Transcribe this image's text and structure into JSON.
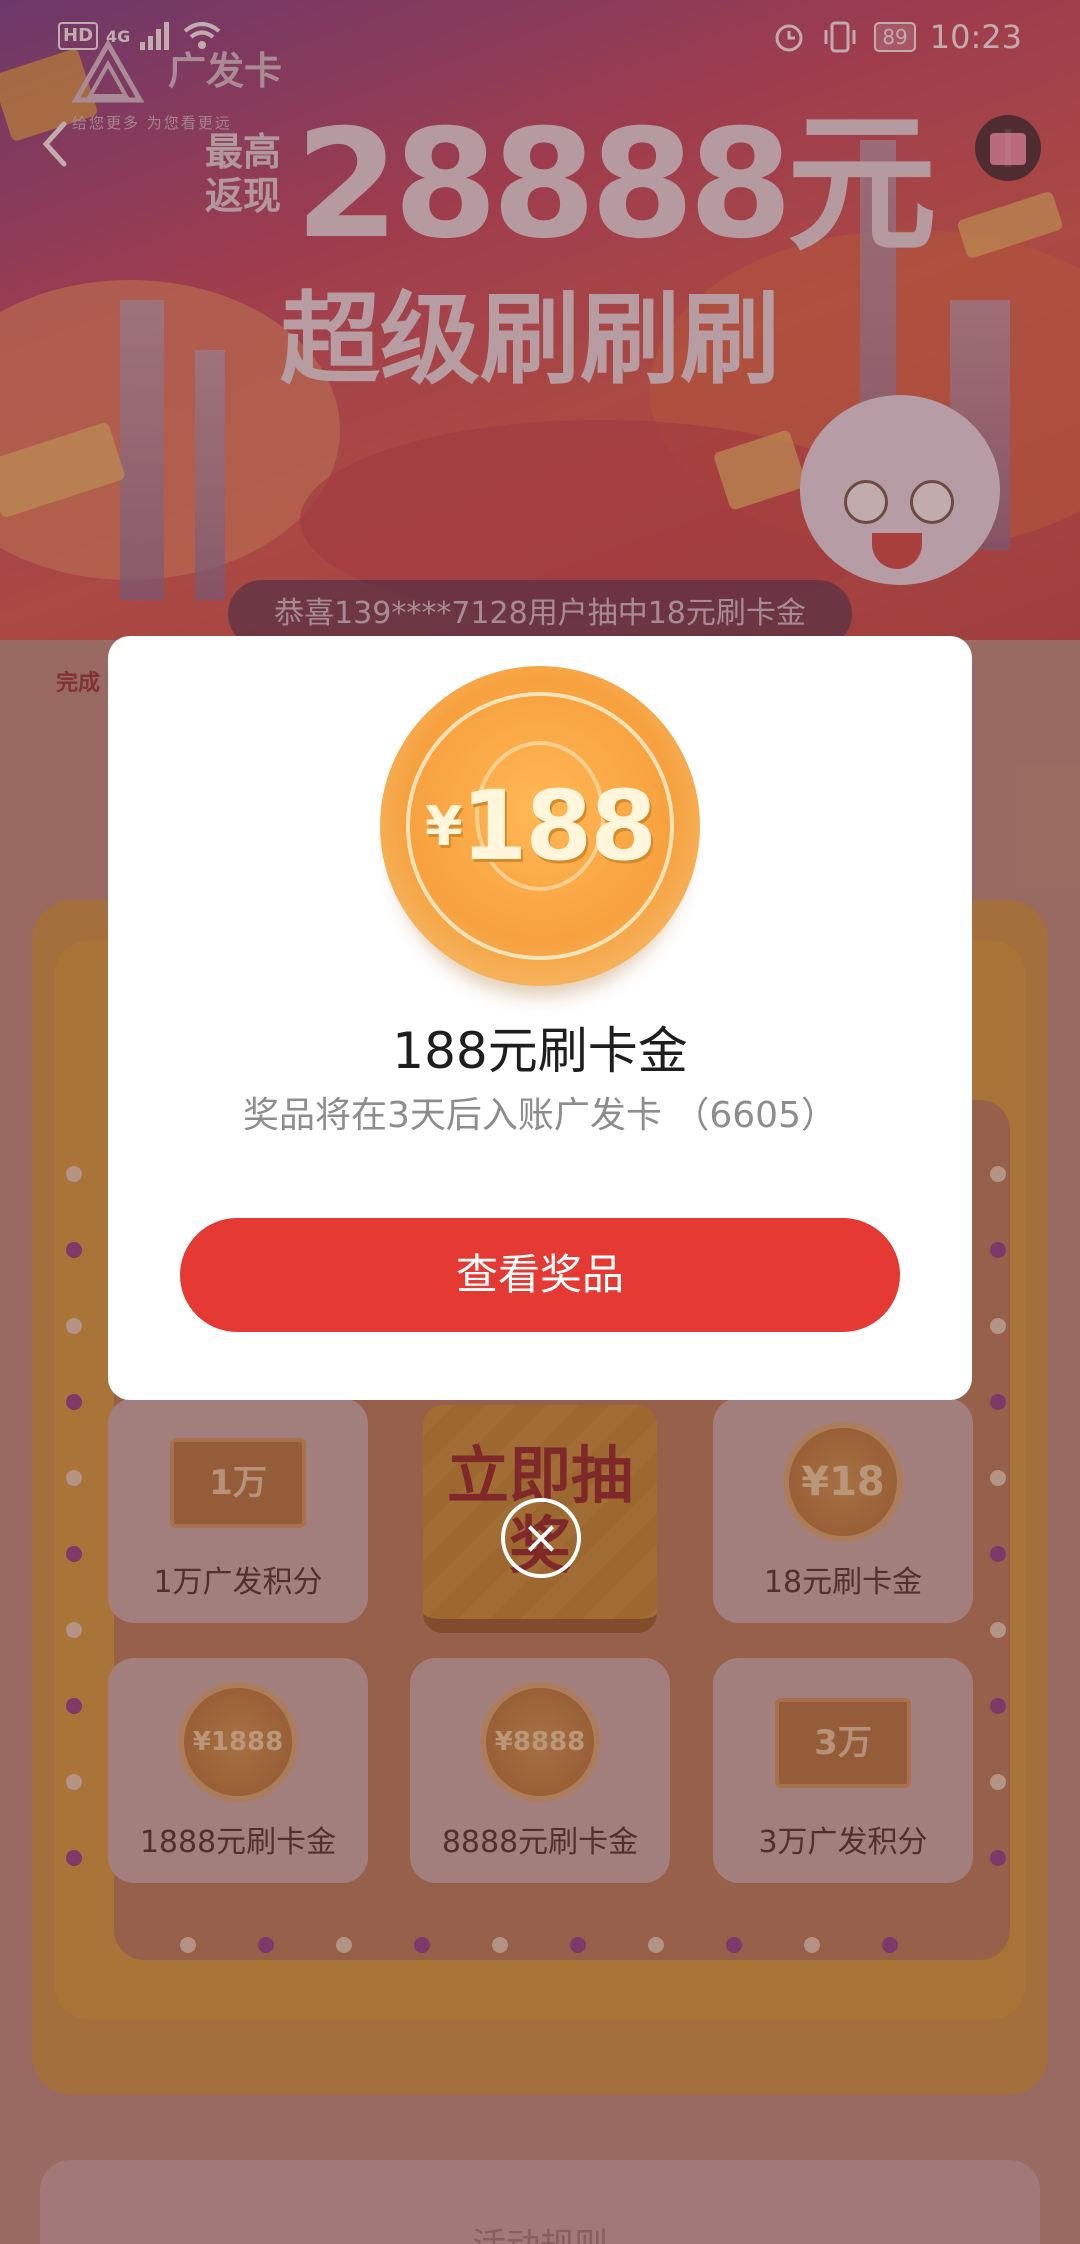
{
  "status_bar": {
    "hd": "HD",
    "network": "4G",
    "battery": "89",
    "time": "10:23"
  },
  "banner": {
    "logo_name": "广发卡",
    "logo_slogan": "给您更多   为您看更远",
    "headline_prefix": "最高返现",
    "headline_amount": "28888元",
    "headline_title": "超级刷刷刷",
    "ticker": "恭喜139****7128用户抽中18元刷卡金",
    "side_text": "完成"
  },
  "grid": {
    "draw_button": "立即抽奖",
    "cells": [
      {
        "label": "1万广发积分",
        "graphic": "1万"
      },
      {
        "label": "18元刷卡金",
        "graphic": "¥18"
      },
      {
        "label": "1888元刷卡金",
        "graphic": "¥1888"
      },
      {
        "label": "8888元刷卡金",
        "graphic": "¥8888"
      },
      {
        "label": "3万广发积分",
        "graphic": "3万"
      }
    ]
  },
  "rules": {
    "title": "活动规则"
  },
  "modal": {
    "coin_currency": "¥",
    "coin_value": "188",
    "prize_title": "188元刷卡金",
    "prize_description": "奖品将在3天后入账广发卡 （6605）",
    "view_button": "查看奖品",
    "close_glyph": "×"
  },
  "colors": {
    "primary_button": "#e53a34",
    "coin_gold": "#f7a13f"
  }
}
